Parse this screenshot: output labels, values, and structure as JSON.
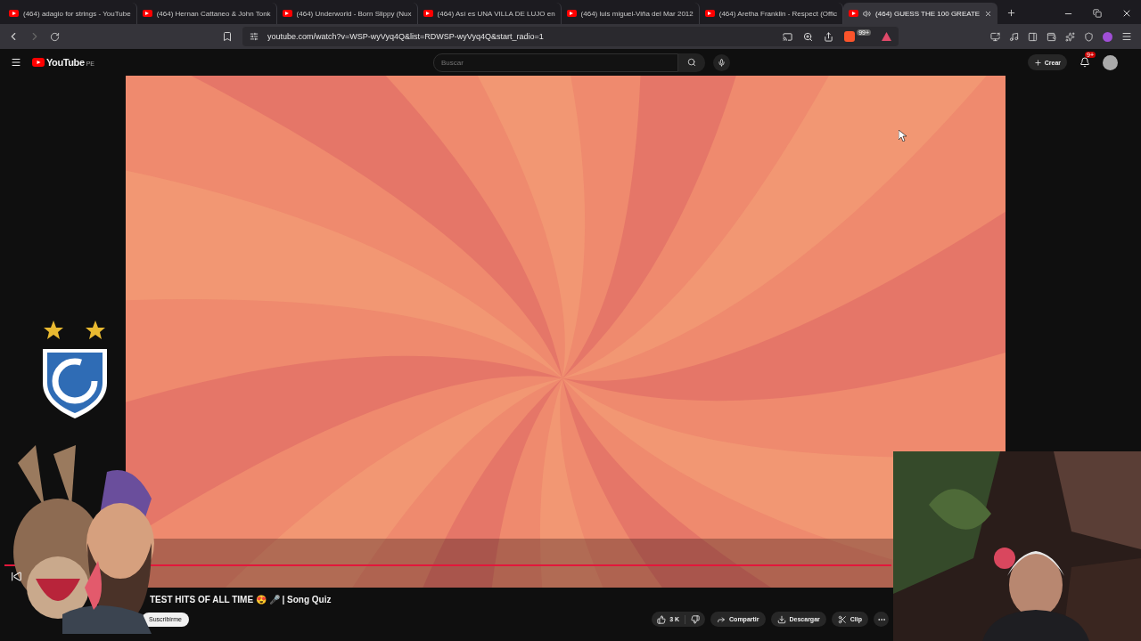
{
  "tabs": [
    {
      "title": "(464) adagio for strings - YouTube",
      "selected": false,
      "audio": false
    },
    {
      "title": "(464) Hernan Cattaneo & John Tonk",
      "selected": false,
      "audio": false
    },
    {
      "title": "(464) Underworld - Born Slippy (Nux",
      "selected": false,
      "audio": false
    },
    {
      "title": "(464) Así es UNA VILLA DE LUJO en",
      "selected": false,
      "audio": false
    },
    {
      "title": "(464) luis miguel-Viña del Mar 2012",
      "selected": false,
      "audio": false
    },
    {
      "title": "(464) Aretha Franklin - Respect (Offic",
      "selected": false,
      "audio": false
    },
    {
      "title": "(464) GUESS THE 100 GREATE",
      "selected": true,
      "audio": true
    }
  ],
  "address": {
    "url": "youtube.com/watch?v=WSP-wyVyq4Q&list=RDWSP-wyVyq4Q&start_radio=1",
    "brave_badge": "99+"
  },
  "header": {
    "logo": "YouTube",
    "region": "PE",
    "search_placeholder": "Buscar",
    "create": "Crear",
    "notifications": "9+"
  },
  "video": {
    "progress": {
      "level": 1
    },
    "title": "TEST HITS OF ALL TIME 😍 🎤 | Song Quiz",
    "subscribe": "Suscribirme",
    "likes": "3 K",
    "actions": [
      {
        "kind": "share",
        "label": "Compartir"
      },
      {
        "kind": "download",
        "label": "Descargar"
      },
      {
        "kind": "clip",
        "label": "Clip"
      }
    ]
  }
}
